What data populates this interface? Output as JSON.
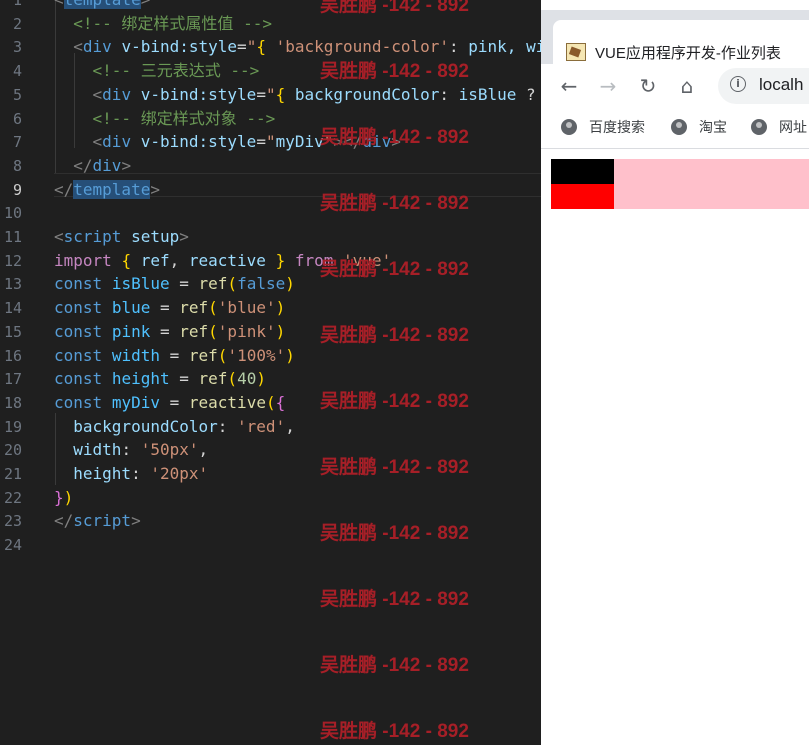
{
  "editor": {
    "active_line": 9,
    "line_numbers": [
      "1",
      "2",
      "3",
      "4",
      "5",
      "6",
      "7",
      "8",
      "9",
      "10",
      "11",
      "12",
      "13",
      "14",
      "15",
      "16",
      "17",
      "18",
      "19",
      "20",
      "21",
      "22",
      "23",
      "24"
    ],
    "lines": [
      [
        {
          "t": "<",
          "c": "bracket"
        },
        {
          "t": "template",
          "c": "tag hl"
        },
        {
          "t": ">",
          "c": "bracket"
        }
      ],
      [
        {
          "t": "  "
        },
        {
          "t": "<!-- 绑定样式属性值 -->",
          "c": "comment"
        }
      ],
      [
        {
          "t": "  "
        },
        {
          "t": "<",
          "c": "bracket"
        },
        {
          "t": "div",
          "c": "tag"
        },
        {
          "t": " v-bind:style",
          "c": "attr"
        },
        {
          "t": "=",
          "c": "plain"
        },
        {
          "t": "\"",
          "c": "str"
        },
        {
          "t": "{",
          "c": "brace"
        },
        {
          "t": " 'background-color'",
          "c": "str"
        },
        {
          "t": ": ",
          "c": "plain"
        },
        {
          "t": "pink",
          "c": "attr"
        },
        {
          "t": ", wi",
          "c": "attr"
        }
      ],
      [
        {
          "t": "    "
        },
        {
          "t": "<!-- 三元表达式 -->",
          "c": "comment"
        }
      ],
      [
        {
          "t": "    "
        },
        {
          "t": "<",
          "c": "bracket"
        },
        {
          "t": "div",
          "c": "tag"
        },
        {
          "t": " v-bind:style",
          "c": "attr"
        },
        {
          "t": "=",
          "c": "plain"
        },
        {
          "t": "\"",
          "c": "str"
        },
        {
          "t": "{",
          "c": "brace"
        },
        {
          "t": " backgroundColor",
          "c": "attr"
        },
        {
          "t": ": ",
          "c": "plain"
        },
        {
          "t": "isBlue",
          "c": "attr"
        },
        {
          "t": " ?",
          "c": "plain"
        }
      ],
      [
        {
          "t": "    "
        },
        {
          "t": "<!-- 绑定样式对象 -->",
          "c": "comment"
        }
      ],
      [
        {
          "t": "    "
        },
        {
          "t": "<",
          "c": "bracket"
        },
        {
          "t": "div",
          "c": "tag"
        },
        {
          "t": " v-bind:style",
          "c": "attr"
        },
        {
          "t": "=",
          "c": "plain"
        },
        {
          "t": "\"",
          "c": "str"
        },
        {
          "t": "myDiv",
          "c": "attr"
        },
        {
          "t": "\"",
          "c": "str"
        },
        {
          "t": "></",
          "c": "bracket"
        },
        {
          "t": "div",
          "c": "tag"
        },
        {
          "t": ">",
          "c": "bracket"
        }
      ],
      [
        {
          "t": "  "
        },
        {
          "t": "</",
          "c": "bracket"
        },
        {
          "t": "div",
          "c": "tag"
        },
        {
          "t": ">",
          "c": "bracket"
        }
      ],
      [
        {
          "t": "</",
          "c": "bracket"
        },
        {
          "t": "template",
          "c": "tag hl"
        },
        {
          "t": ">",
          "c": "bracket"
        }
      ],
      [],
      [
        {
          "t": "<",
          "c": "bracket"
        },
        {
          "t": "script",
          "c": "tag"
        },
        {
          "t": " setup",
          "c": "attr"
        },
        {
          "t": ">",
          "c": "bracket"
        }
      ],
      [
        {
          "t": "import",
          "c": "import"
        },
        {
          "t": " "
        },
        {
          "t": "{",
          "c": "brace"
        },
        {
          "t": " ref",
          "c": "attr"
        },
        {
          "t": ", ",
          "c": "plain"
        },
        {
          "t": "reactive",
          "c": "attr"
        },
        {
          "t": " "
        },
        {
          "t": "}",
          "c": "brace"
        },
        {
          "t": " "
        },
        {
          "t": "from",
          "c": "import"
        },
        {
          "t": " "
        },
        {
          "t": "'vue'",
          "c": "str"
        }
      ],
      [
        {
          "t": "const",
          "c": "kw"
        },
        {
          "t": " "
        },
        {
          "t": "isBlue",
          "c": "var"
        },
        {
          "t": " = ",
          "c": "plain"
        },
        {
          "t": "ref",
          "c": "fn"
        },
        {
          "t": "(",
          "c": "brace"
        },
        {
          "t": "false",
          "c": "kw"
        },
        {
          "t": ")",
          "c": "brace"
        }
      ],
      [
        {
          "t": "const",
          "c": "kw"
        },
        {
          "t": " "
        },
        {
          "t": "blue",
          "c": "var"
        },
        {
          "t": " = ",
          "c": "plain"
        },
        {
          "t": "ref",
          "c": "fn"
        },
        {
          "t": "(",
          "c": "brace"
        },
        {
          "t": "'blue'",
          "c": "str"
        },
        {
          "t": ")",
          "c": "brace"
        }
      ],
      [
        {
          "t": "const",
          "c": "kw"
        },
        {
          "t": " "
        },
        {
          "t": "pink",
          "c": "var"
        },
        {
          "t": " = ",
          "c": "plain"
        },
        {
          "t": "ref",
          "c": "fn"
        },
        {
          "t": "(",
          "c": "brace"
        },
        {
          "t": "'pink'",
          "c": "str"
        },
        {
          "t": ")",
          "c": "brace"
        }
      ],
      [
        {
          "t": "const",
          "c": "kw"
        },
        {
          "t": " "
        },
        {
          "t": "width",
          "c": "var"
        },
        {
          "t": " = ",
          "c": "plain"
        },
        {
          "t": "ref",
          "c": "fn"
        },
        {
          "t": "(",
          "c": "brace"
        },
        {
          "t": "'100%'",
          "c": "str"
        },
        {
          "t": ")",
          "c": "brace"
        }
      ],
      [
        {
          "t": "const",
          "c": "kw"
        },
        {
          "t": " "
        },
        {
          "t": "height",
          "c": "var"
        },
        {
          "t": " = ",
          "c": "plain"
        },
        {
          "t": "ref",
          "c": "fn"
        },
        {
          "t": "(",
          "c": "brace"
        },
        {
          "t": "40",
          "c": "num"
        },
        {
          "t": ")",
          "c": "brace"
        }
      ],
      [
        {
          "t": "const",
          "c": "kw"
        },
        {
          "t": " "
        },
        {
          "t": "myDiv",
          "c": "var"
        },
        {
          "t": " = ",
          "c": "plain"
        },
        {
          "t": "reactive",
          "c": "fn"
        },
        {
          "t": "(",
          "c": "brace"
        },
        {
          "t": "{",
          "c": "brace2"
        }
      ],
      [
        {
          "t": "  backgroundColor",
          "c": "attr"
        },
        {
          "t": ": ",
          "c": "plain"
        },
        {
          "t": "'red'",
          "c": "str"
        },
        {
          "t": ",",
          "c": "plain"
        }
      ],
      [
        {
          "t": "  width",
          "c": "attr"
        },
        {
          "t": ": ",
          "c": "plain"
        },
        {
          "t": "'50px'",
          "c": "str"
        },
        {
          "t": ",",
          "c": "plain"
        }
      ],
      [
        {
          "t": "  height",
          "c": "attr"
        },
        {
          "t": ": ",
          "c": "plain"
        },
        {
          "t": "'20px'",
          "c": "str"
        }
      ],
      [
        {
          "t": "}",
          "c": "brace2"
        },
        {
          "t": ")",
          "c": "brace"
        }
      ],
      [
        {
          "t": "</",
          "c": "bracket"
        },
        {
          "t": "script",
          "c": "tag"
        },
        {
          "t": ">",
          "c": "bracket"
        }
      ],
      []
    ]
  },
  "watermark": {
    "text": "吴胜鹏 -142 - 892",
    "color": "#a61f27",
    "count": 12
  },
  "browser": {
    "tab_title": "VUE应用程序开发-作业列表",
    "favicon": "page-favicon",
    "back_icon": "←",
    "forward_icon": "→",
    "reload_icon": "↻",
    "home_icon": "⌂",
    "info_icon": "i",
    "url": "localh",
    "bookmarks": [
      {
        "label": "百度搜索",
        "icon": "globe-icon"
      },
      {
        "label": "淘宝",
        "icon": "globe-icon"
      },
      {
        "label": "网址",
        "icon": "globe-icon"
      }
    ],
    "content_colors": {
      "outer": "#ffc0cb",
      "inner_top": "#000000",
      "inner_bottom": "#ff0000"
    }
  }
}
